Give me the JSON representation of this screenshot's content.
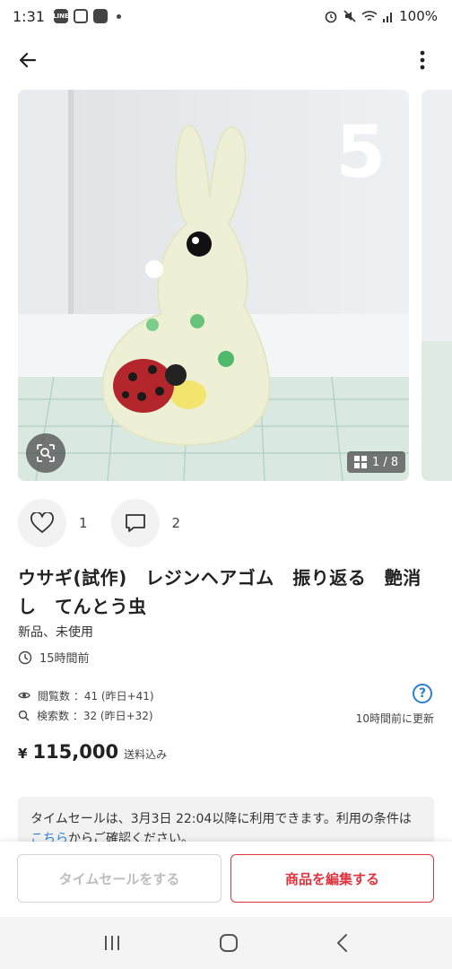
{
  "status_bar": {
    "time": "1:31",
    "left_icons": [
      "line-icon",
      "instagram-icon",
      "gallery-icon"
    ],
    "right_icons": [
      "alarm-icon",
      "mute-icon",
      "wifi-icon",
      "signal-icon"
    ],
    "battery": "100%"
  },
  "app_bar": {
    "back_icon": "arrow-left-icon",
    "menu_icon": "more-vertical-icon"
  },
  "gallery": {
    "image_description_icon": "rabbit-resin-photo",
    "overlay_number": "5",
    "counter": "1 / 8",
    "current_index": 1,
    "total": 8
  },
  "actions": {
    "likes": "1",
    "comments": "2"
  },
  "item": {
    "title": "ウサギ(試作)　レジンヘアゴム　振り返る　艶消し　てんとう虫",
    "condition": "新品、未使用",
    "posted_ago": "15時間前"
  },
  "stats": {
    "views": "閲覧数 ：41 (昨日+41)",
    "searches": "検索数 ：32 (昨日+32)",
    "help": "?",
    "updated": "10時間前に更新"
  },
  "price": {
    "currency": "¥",
    "amount": "115,000",
    "tax_note": "送料込み"
  },
  "notice": {
    "text_before": "タイムセールは、3月3日 22:04以降に利用できます。利用の条件は",
    "link": "こちら",
    "text_after": "からご確認ください。"
  },
  "buttons": {
    "time_sale": "タイムセールをする",
    "edit": "商品を編集する"
  },
  "colors": {
    "accent_red": "#e0343f",
    "link_blue": "#2b7ed1"
  }
}
